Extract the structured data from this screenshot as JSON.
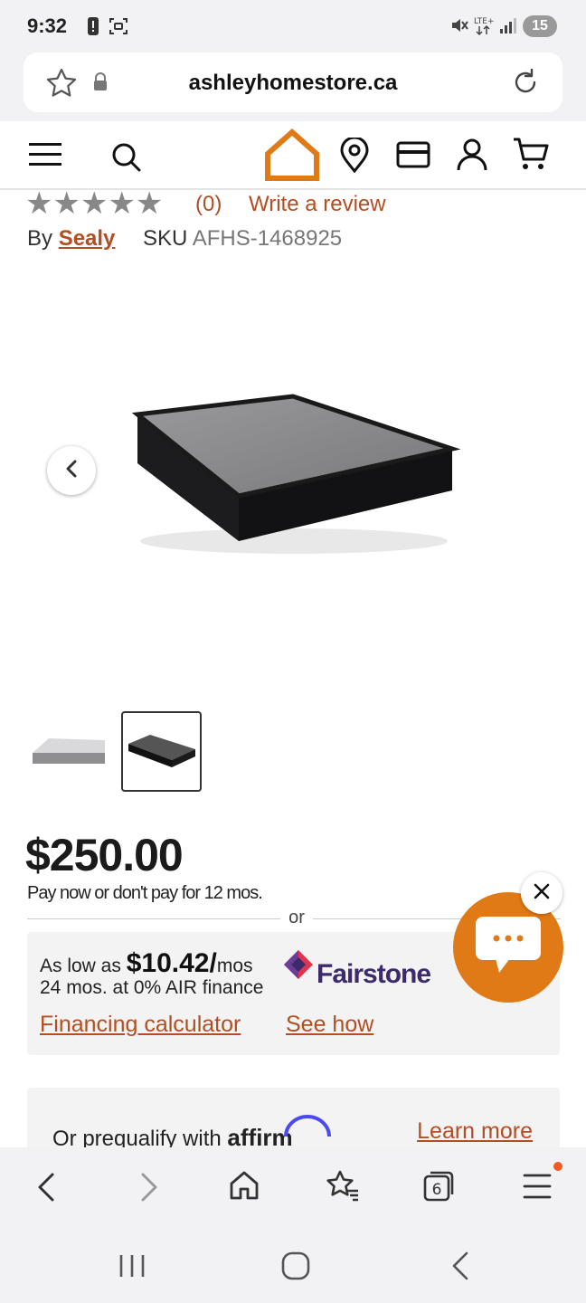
{
  "status_bar": {
    "time": "9:32",
    "badge": "15",
    "icons": [
      "alert-icon",
      "screenshot-icon",
      "mute-icon",
      "lte-icon",
      "signal-icon"
    ]
  },
  "browser": {
    "url": "ashleyhomestore.ca",
    "tab_count": "6"
  },
  "site_header": {
    "icons": [
      "menu-icon",
      "search-icon",
      "home-logo-icon",
      "location-icon",
      "card-icon",
      "account-icon",
      "cart-icon"
    ],
    "accent_color": "#e07a16"
  },
  "product": {
    "stars": "★★★★★",
    "review_count": "(0)",
    "write_review": "Write a review",
    "by_label": "By",
    "brand": "Sealy",
    "sku_label": "SKU",
    "sku": "AFHS-1468925",
    "price": "$250.00",
    "pay_now": "Pay now or don't pay for 12 mos.",
    "or": "or"
  },
  "financing": {
    "as_low_as": "As low as",
    "monthly": "$10.42",
    "slash": "/",
    "per": "mos",
    "terms": "24 mos. at 0% AIR finance",
    "provider": "Fairstone",
    "calculator_link": "Financing calculator",
    "see_how_link": "See how"
  },
  "affirm": {
    "prequalify": "Or prequalify with",
    "brand": "affirm",
    "learn_more": "Learn more"
  },
  "link_color": "#b44d21"
}
